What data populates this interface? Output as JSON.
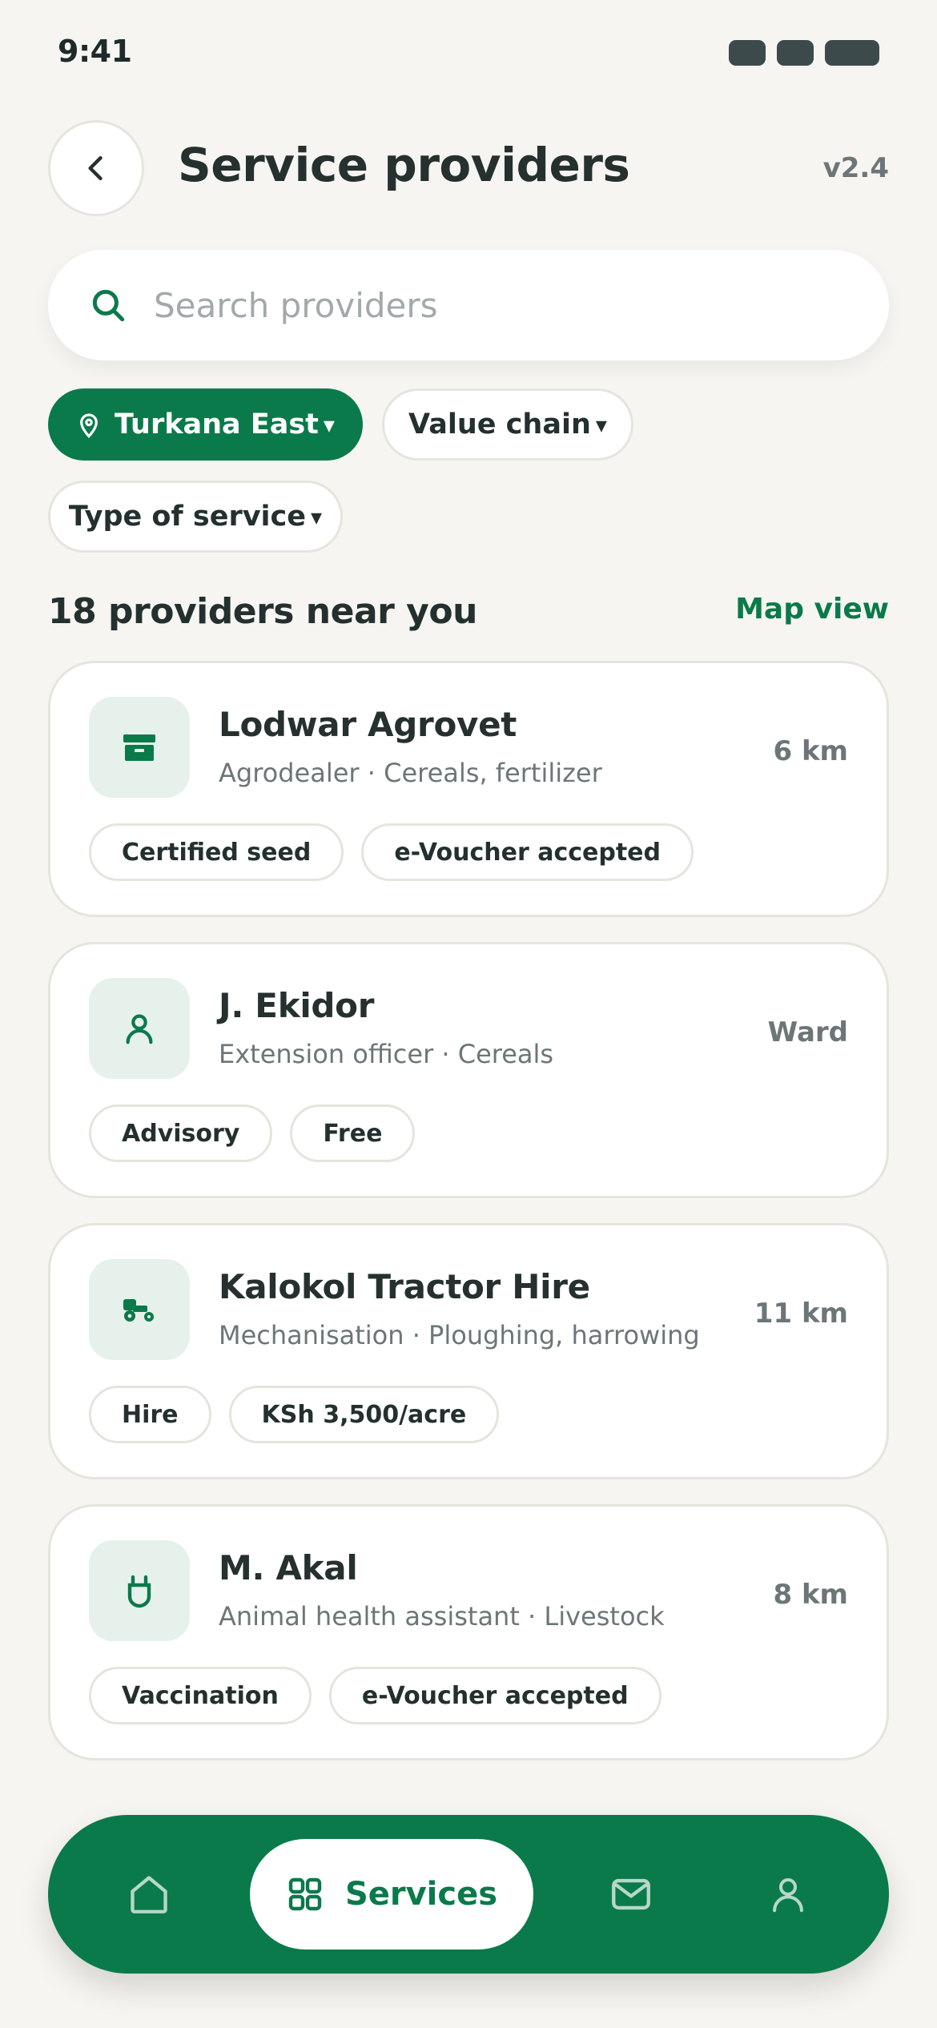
{
  "status_bar": {
    "time": "9:41"
  },
  "header": {
    "title": "Service providers",
    "version": "v2.4"
  },
  "search": {
    "placeholder": "Search providers",
    "value": ""
  },
  "filters": [
    {
      "label": "Turkana East",
      "caret": "▾",
      "active": true,
      "icon": "location-pin-icon"
    },
    {
      "label": "Value chain",
      "caret": "▾",
      "active": false
    },
    {
      "label": "Type of service",
      "caret": "▾",
      "active": false
    }
  ],
  "results": {
    "count_label": "18 providers near you",
    "map_view_label": "Map view"
  },
  "providers": [
    {
      "name": "Lodwar Agrovet",
      "meta": "Agrodealer · Cereals, fertilizer",
      "distance": "6 km",
      "icon": "store-icon",
      "tags": [
        "Certified seed",
        "e-Voucher accepted"
      ]
    },
    {
      "name": "J. Ekidor",
      "meta": "Extension officer · Cereals",
      "distance": "Ward",
      "icon": "person-icon",
      "tags": [
        "Advisory",
        "Free"
      ]
    },
    {
      "name": "Kalokol Tractor Hire",
      "meta": "Mechanisation · Ploughing, harrowing",
      "distance": "11 km",
      "icon": "tractor-icon",
      "tags": [
        "Hire",
        "KSh 3,500/acre"
      ]
    },
    {
      "name": "M. Akal",
      "meta": "Animal health assistant · Livestock",
      "distance": "8 km",
      "icon": "livestock-icon",
      "tags": [
        "Vaccination",
        "e-Voucher accepted"
      ]
    }
  ],
  "bottom_nav": {
    "items": [
      {
        "id": "home",
        "icon": "home-icon"
      },
      {
        "id": "services",
        "label": "Services",
        "icon": "grid-icon",
        "active": true
      },
      {
        "id": "messages",
        "icon": "mail-icon"
      },
      {
        "id": "profile",
        "icon": "profile-icon"
      }
    ]
  },
  "colors": {
    "brand": "#0a7a4a",
    "background": "#f6f5f1",
    "avatar_bg": "#e6f1ec",
    "text": "#23302f",
    "muted": "#6c7678"
  }
}
